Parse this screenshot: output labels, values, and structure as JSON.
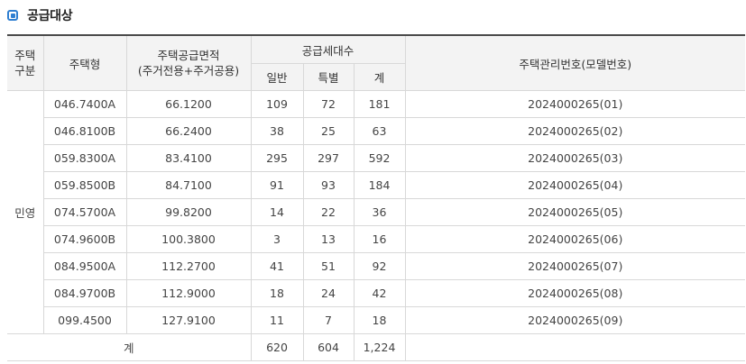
{
  "section": {
    "title": "공급대상"
  },
  "headers": {
    "housing_category": "주택\n구분",
    "housing_type": "주택형",
    "supply_area": "주택공급면적\n(주거전용+주거공용)",
    "supply_units": "공급세대수",
    "general": "일반",
    "special": "특별",
    "total": "계",
    "mgmt_number": "주택관리번호(모델번호)"
  },
  "category_label": "민영",
  "rows": [
    {
      "type": "046.7400A",
      "area": "66.1200",
      "general": "109",
      "special": "72",
      "total": "181",
      "mgmt": "2024000265(01)"
    },
    {
      "type": "046.8100B",
      "area": "66.2400",
      "general": "38",
      "special": "25",
      "total": "63",
      "mgmt": "2024000265(02)"
    },
    {
      "type": "059.8300A",
      "area": "83.4100",
      "general": "295",
      "special": "297",
      "total": "592",
      "mgmt": "2024000265(03)"
    },
    {
      "type": "059.8500B",
      "area": "84.7100",
      "general": "91",
      "special": "93",
      "total": "184",
      "mgmt": "2024000265(04)"
    },
    {
      "type": "074.5700A",
      "area": "99.8200",
      "general": "14",
      "special": "22",
      "total": "36",
      "mgmt": "2024000265(05)"
    },
    {
      "type": "074.9600B",
      "area": "100.3800",
      "general": "3",
      "special": "13",
      "total": "16",
      "mgmt": "2024000265(06)"
    },
    {
      "type": "084.9500A",
      "area": "112.2700",
      "general": "41",
      "special": "51",
      "total": "92",
      "mgmt": "2024000265(07)"
    },
    {
      "type": "084.9700B",
      "area": "112.9000",
      "general": "18",
      "special": "24",
      "total": "42",
      "mgmt": "2024000265(08)"
    },
    {
      "type": "099.4500",
      "area": "127.9100",
      "general": "11",
      "special": "7",
      "total": "18",
      "mgmt": "2024000265(09)"
    }
  ],
  "totals": {
    "label": "계",
    "general": "620",
    "special": "604",
    "total": "1,224"
  }
}
